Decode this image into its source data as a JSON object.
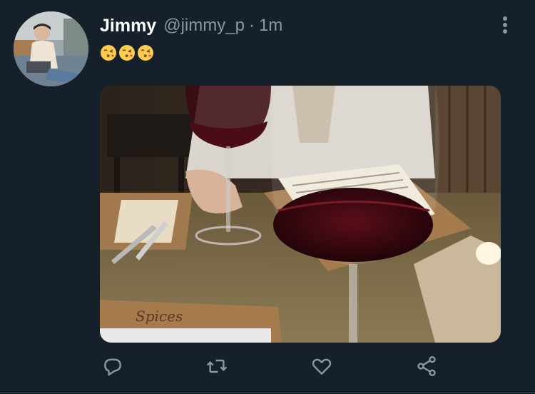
{
  "tweet": {
    "author": {
      "display_name": "Jimmy",
      "handle": "@jimmy_p",
      "avatar": "profile-photo"
    },
    "separator": "·",
    "time_ago": "1m",
    "text_emojis": [
      "kissing-face-emoji",
      "kissing-face-emoji",
      "kissing-face-emoji"
    ],
    "media": {
      "type": "photo",
      "image_text": "Spices"
    },
    "actions": [
      "reply-icon",
      "retweet-icon",
      "like-icon",
      "share-icon"
    ]
  },
  "colors": {
    "background": "#15202b",
    "secondary_text": "#8899a6",
    "divider": "#38444d"
  }
}
